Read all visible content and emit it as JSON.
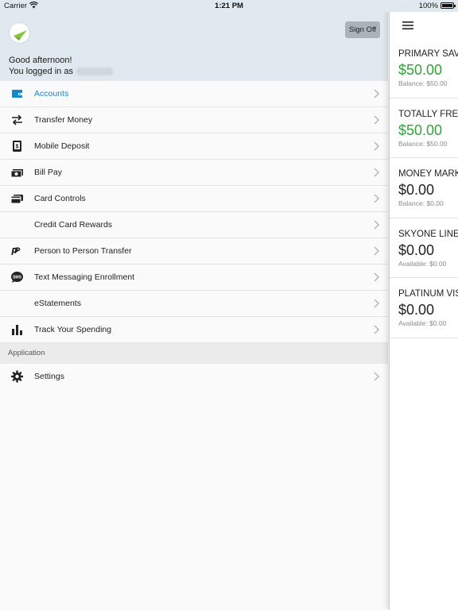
{
  "status_bar": {
    "carrier": "Carrier",
    "time": "1:21 PM",
    "battery": "100%"
  },
  "header": {
    "greeting": "Good afternoon!",
    "logged_in_prefix": "You logged in as",
    "sign_off_label": "Sign Off"
  },
  "menu": {
    "items": [
      {
        "label": "Accounts",
        "icon": "wallet-icon"
      },
      {
        "label": "Transfer Money",
        "icon": "transfer-arrows-icon"
      },
      {
        "label": "Mobile Deposit",
        "icon": "mobile-deposit-icon"
      },
      {
        "label": "Bill Pay",
        "icon": "bill-pay-icon"
      },
      {
        "label": "Card Controls",
        "icon": "card-icon"
      },
      {
        "label": "Credit Card Rewards",
        "icon": ""
      },
      {
        "label": "Person to Person Transfer",
        "icon": "paypal-icon"
      },
      {
        "label": "Text Messaging Enrollment",
        "icon": "sms-icon"
      },
      {
        "label": "eStatements",
        "icon": ""
      },
      {
        "label": "Track Your Spending",
        "icon": "bar-chart-icon"
      }
    ],
    "section_label": "Application",
    "settings_label": "Settings"
  },
  "accounts": [
    {
      "name": "PRIMARY SAV",
      "amount": "$50.00",
      "sub": "Balance: $50.00"
    },
    {
      "name": "TOTALLY FRE",
      "amount": "$50.00",
      "sub": "Balance: $50.00"
    },
    {
      "name": "MONEY MARK",
      "amount": "$0.00",
      "sub": "Balance: $0.00"
    },
    {
      "name": "SKYONE LINE",
      "amount": "$0.00",
      "sub": "Available: $0.00"
    },
    {
      "name": "PLATINUM VIS",
      "amount": "$0.00",
      "sub": "Available: $0.00"
    }
  ],
  "colors": {
    "accent": "#1588c8",
    "positive_balance": "#35a03b",
    "header_bg": "#dfe9ef"
  }
}
